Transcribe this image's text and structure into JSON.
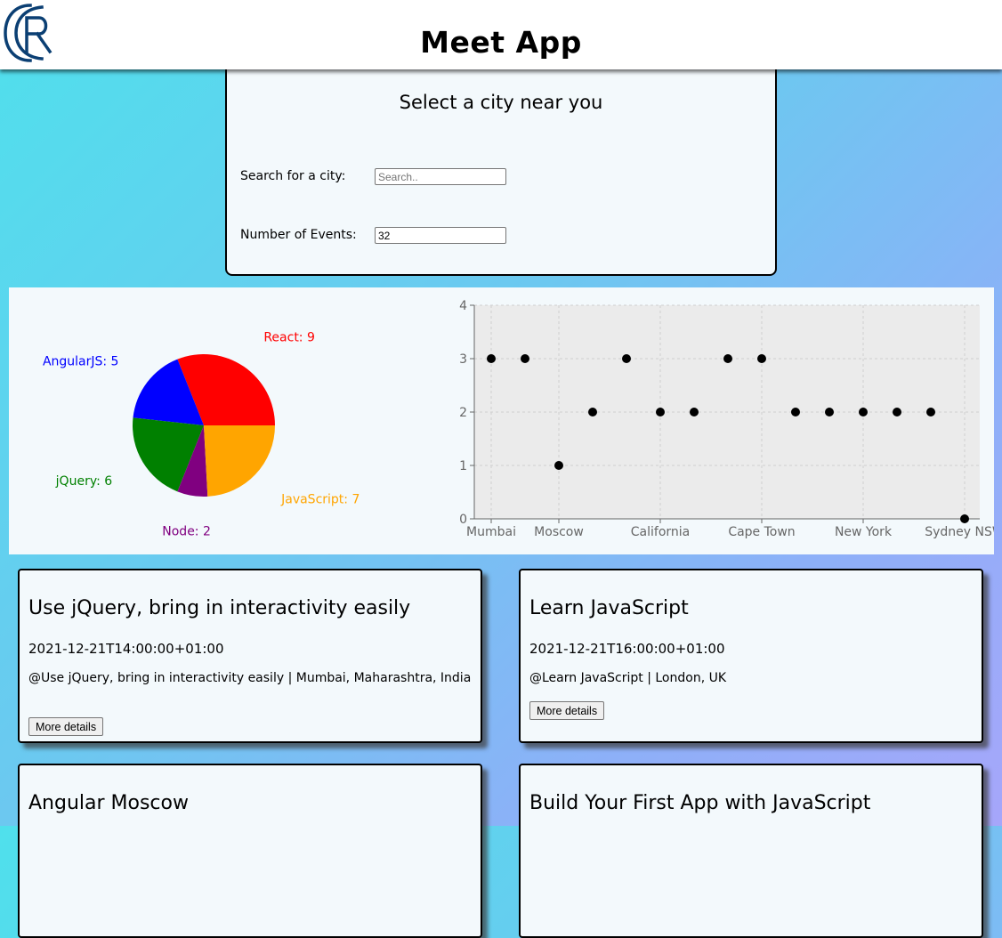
{
  "header": {
    "title": "Meet App"
  },
  "city_search": {
    "title": "Select a city near you",
    "search_label": "Search for a city:",
    "search_placeholder": "Search..",
    "events_label": "Number of Events:",
    "events_value": "32"
  },
  "chart_data": [
    {
      "type": "pie",
      "labels": [
        "React",
        "AngularJS",
        "jQuery",
        "Node",
        "JavaScript"
      ],
      "values": [
        9,
        5,
        6,
        2,
        7
      ],
      "colors": [
        "#ff0000",
        "#0000ff",
        "#008000",
        "#800080",
        "#ffa500"
      ],
      "slice_labels": [
        "React: 9",
        "AngularJS: 5",
        "jQuery: 6",
        "Node: 2",
        "JavaScript: 7"
      ]
    },
    {
      "type": "scatter",
      "categories": [
        "Mumbai",
        "",
        "Moscow",
        "",
        "",
        "California",
        "",
        "",
        "Cape Town",
        "",
        "",
        "New York",
        "",
        "",
        "Sydney NSW"
      ],
      "tick_labels": [
        "Mumbai",
        "Moscow",
        "California",
        "Cape Town",
        "New York",
        "Sydney NSW"
      ],
      "values": [
        3,
        3,
        1,
        2,
        3,
        2,
        2,
        3,
        3,
        2,
        2,
        2,
        2,
        2,
        0
      ],
      "ylim": [
        0,
        4
      ],
      "yticks": [
        "0",
        "1",
        "2",
        "3",
        "4"
      ],
      "grid": true,
      "point_color": "#000000",
      "plot_background": "#ebebeb"
    }
  ],
  "events": [
    {
      "title": "Use jQuery, bring in interactivity easily",
      "time": "2021-12-21T14:00:00+01:00",
      "location": "@Use jQuery, bring in interactivity easily | Mumbai, Maharashtra, India",
      "button": "More details"
    },
    {
      "title": "Learn JavaScript",
      "time": "2021-12-21T16:00:00+01:00",
      "location": "@Learn JavaScript | London, UK",
      "button": "More details"
    },
    {
      "title": "Angular Moscow"
    },
    {
      "title": "Build Your First App with JavaScript"
    }
  ]
}
